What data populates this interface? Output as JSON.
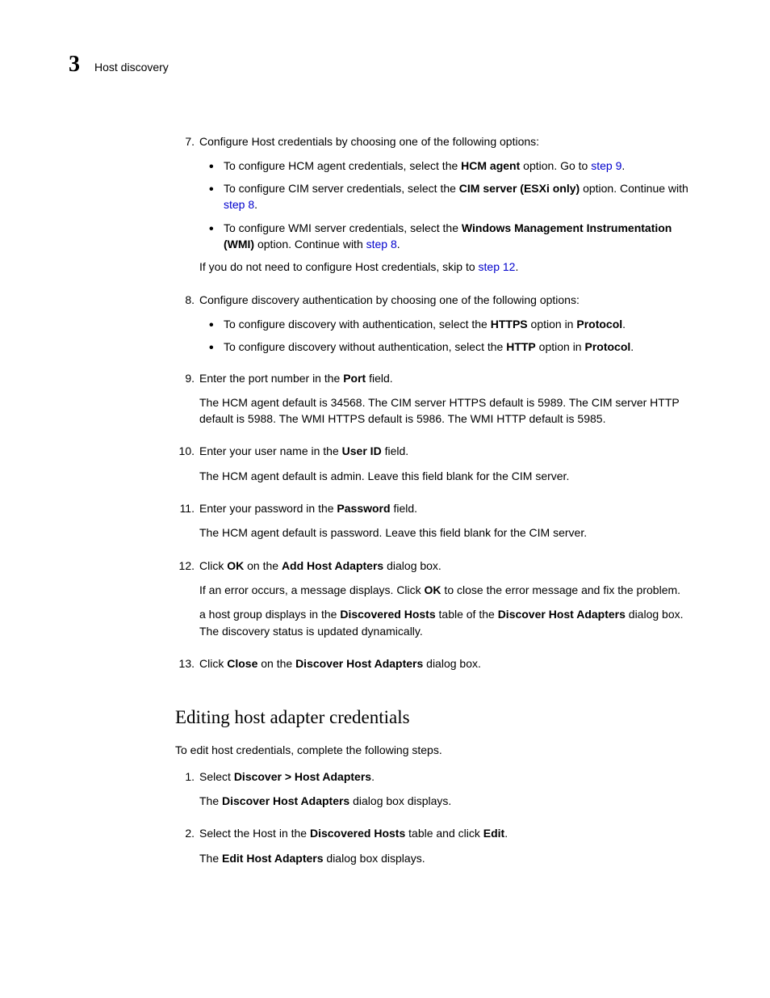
{
  "header": {
    "chapter": "3",
    "title": "Host discovery"
  },
  "s7": {
    "num": "7.",
    "lead": "Configure Host credentials by choosing one of the following options:",
    "b1a": "To configure HCM agent credentials, select the ",
    "b1b": "HCM agent",
    "b1c": " option. Go to ",
    "b1d": "step 9",
    "b1e": ".",
    "b2a": "To configure CIM server credentials, select the ",
    "b2b": "CIM server (ESXi only)",
    "b2c": " option. Continue with ",
    "b2d": "step 8",
    "b2e": ".",
    "b3a": "To configure WMI server credentials, select the ",
    "b3b": "Windows Management Instrumentation (WMI)",
    "b3c": " option. Continue with ",
    "b3d": "step 8",
    "b3e": ".",
    "tail_a": "If you do not need to configure Host credentials, skip to ",
    "tail_b": "step 12",
    "tail_c": "."
  },
  "s8": {
    "num": "8.",
    "lead": "Configure discovery authentication by choosing one of the following options:",
    "b1a": "To configure discovery with authentication, select the ",
    "b1b": "HTTPS",
    "b1c": " option in ",
    "b1d": "Protocol",
    "b1e": ".",
    "b2a": "To configure discovery without authentication, select the ",
    "b2b": "HTTP",
    "b2c": " option in ",
    "b2d": "Protocol",
    "b2e": "."
  },
  "s9": {
    "num": "9.",
    "lead_a": "Enter the port number in the ",
    "lead_b": "Port",
    "lead_c": " field.",
    "para": "The HCM agent default is 34568. The CIM server HTTPS default is 5989. The CIM server HTTP default is 5988. The WMI HTTPS default is 5986. The WMI HTTP default is 5985."
  },
  "s10": {
    "num": "10.",
    "lead_a": "Enter your user name in the ",
    "lead_b": "User ID",
    "lead_c": " field.",
    "para": "The HCM agent default is admin. Leave this field blank for the CIM server."
  },
  "s11": {
    "num": "11.",
    "lead_a": "Enter your password in the ",
    "lead_b": "Password",
    "lead_c": " field.",
    "para": "The HCM agent default is password. Leave this field blank for the CIM server."
  },
  "s12": {
    "num": "12.",
    "lead_a": "Click ",
    "lead_b": "OK",
    "lead_c": " on the ",
    "lead_d": "Add Host Adapters",
    "lead_e": " dialog box.",
    "p1a": "If an error occurs, a message displays. Click ",
    "p1b": "OK",
    "p1c": " to close the error message and fix the problem.",
    "p2a": "a host group displays in the ",
    "p2b": "Discovered Hosts",
    "p2c": " table of the ",
    "p2d": "Discover Host Adapters",
    "p2e": " dialog box. The discovery status is updated dynamically."
  },
  "s13": {
    "num": "13.",
    "lead_a": "Click ",
    "lead_b": "Close",
    "lead_c": " on the ",
    "lead_d": "Discover Host Adapters",
    "lead_e": " dialog box."
  },
  "section": {
    "title": "Editing host adapter credentials",
    "intro": "To edit host credentials, complete the following steps."
  },
  "e1": {
    "num": "1.",
    "lead_a": "Select ",
    "lead_b": "Discover > Host Adapters",
    "lead_c": ".",
    "p_a": "The ",
    "p_b": "Discover Host Adapters",
    "p_c": " dialog box displays."
  },
  "e2": {
    "num": "2.",
    "lead_a": "Select the Host in the ",
    "lead_b": "Discovered Hosts",
    "lead_c": " table and click ",
    "lead_d": "Edit",
    "lead_e": ".",
    "p_a": "The ",
    "p_b": "Edit Host Adapters",
    "p_c": " dialog box displays."
  }
}
